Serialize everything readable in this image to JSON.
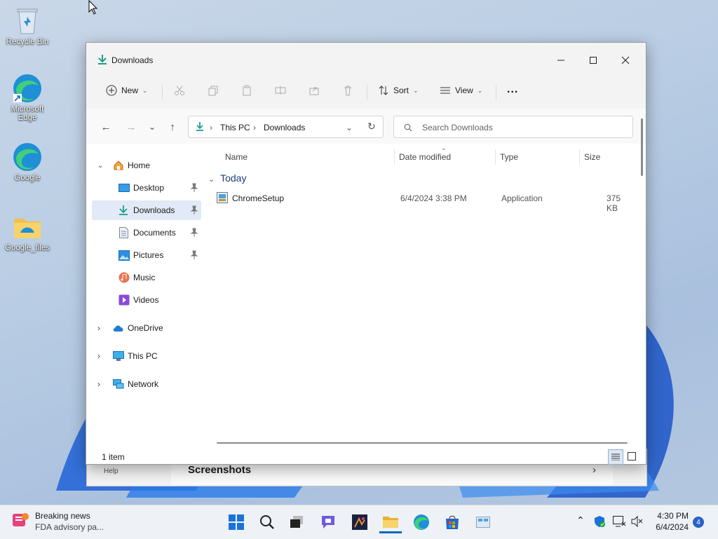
{
  "desktop": {
    "icons": [
      {
        "label": "Recycle Bin"
      },
      {
        "label": "Microsoft Edge"
      },
      {
        "label": "Google"
      },
      {
        "label": "Google_files"
      }
    ]
  },
  "background_window": {
    "help_label": "Help",
    "section_label": "Screenshots"
  },
  "window": {
    "title": "Downloads",
    "commandbar": {
      "new_label": "New",
      "sort_label": "Sort",
      "view_label": "View",
      "more_label": "..."
    },
    "address": {
      "segments": [
        "This PC",
        "Downloads"
      ],
      "search_placeholder": "Search Downloads"
    },
    "sidebar": {
      "home": "Home",
      "quick": [
        "Desktop",
        "Downloads",
        "Documents",
        "Pictures",
        "Music",
        "Videos"
      ],
      "onedrive": "OneDrive",
      "thispc": "This PC",
      "network": "Network"
    },
    "columns": [
      "Name",
      "Date modified",
      "Type",
      "Size"
    ],
    "group_label": "Today",
    "files": [
      {
        "name": "ChromeSetup",
        "date": "6/4/2024 3:38 PM",
        "type": "Application",
        "size": "375 KB"
      }
    ],
    "status": "1 item"
  },
  "taskbar": {
    "news_title": "Breaking news",
    "news_sub": "FDA advisory pa...",
    "time": "4:30 PM",
    "date": "6/4/2024",
    "notification_count": "4"
  },
  "colors": {
    "accent": "#0067c0",
    "selection": "#e1eaf6",
    "folder": "#f2c04b"
  }
}
